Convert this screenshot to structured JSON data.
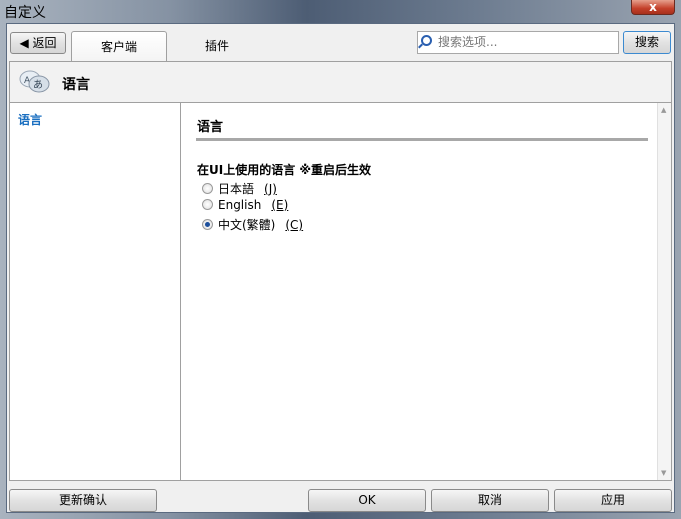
{
  "window": {
    "title": "自定义",
    "close_label": "x"
  },
  "toolbar": {
    "back_label": "返回",
    "tabs": [
      {
        "label": "客户端"
      },
      {
        "label": "插件"
      }
    ],
    "search_placeholder": "搜索选项...",
    "search_button": "搜索"
  },
  "header": {
    "title": "语言"
  },
  "sidebar": {
    "items": [
      {
        "label": "语言"
      }
    ]
  },
  "content": {
    "section_title": "语言",
    "setting_label": "在UI上使用的语言 ※重启后生效",
    "options": [
      {
        "label": "日本語",
        "key": "(J)",
        "selected": false
      },
      {
        "label": "English",
        "key": "(E)",
        "selected": false
      },
      {
        "label": "中文(繁體)",
        "key": "(C)",
        "selected": true
      }
    ]
  },
  "footer": {
    "update_label": "更新确认",
    "ok_label": "OK",
    "cancel_label": "取消",
    "apply_label": "应用"
  }
}
